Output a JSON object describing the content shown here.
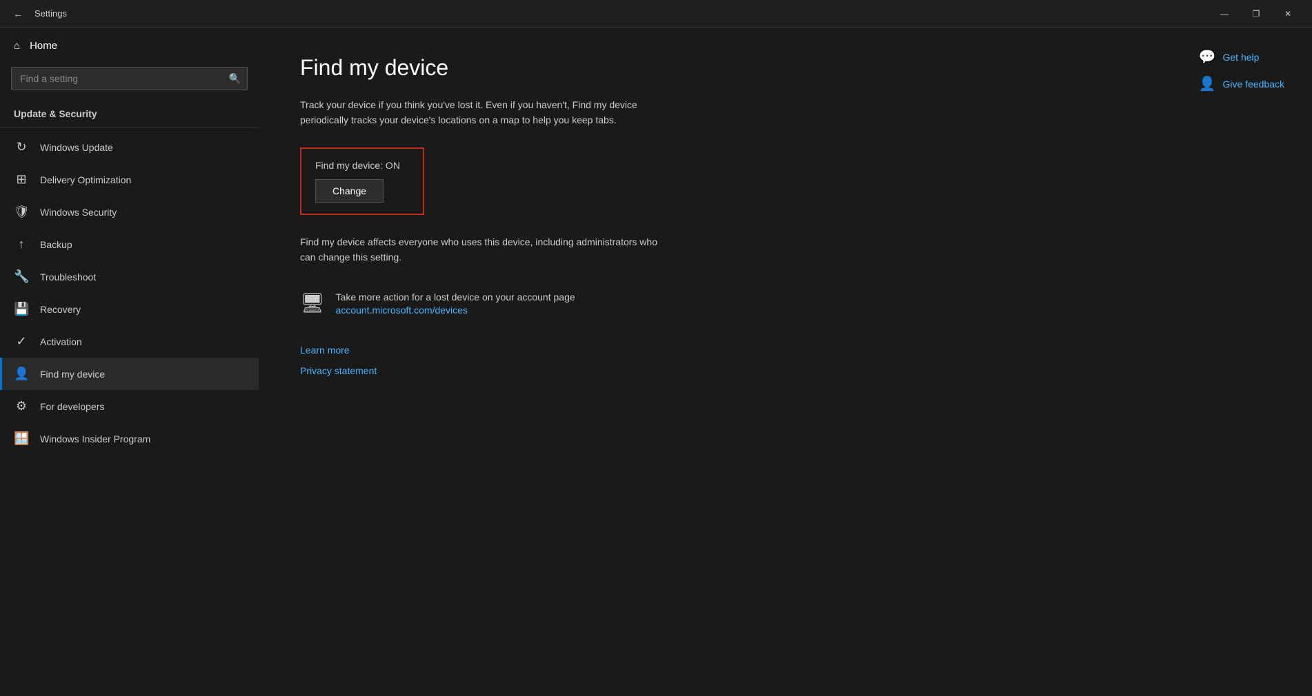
{
  "titlebar": {
    "title": "Settings",
    "back_label": "←",
    "minimize_label": "—",
    "restore_label": "❐",
    "close_label": "✕"
  },
  "sidebar": {
    "home_label": "Home",
    "search_placeholder": "Find a setting",
    "section_title": "Update & Security",
    "items": [
      {
        "id": "windows-update",
        "label": "Windows Update",
        "icon": "↻"
      },
      {
        "id": "delivery-optimization",
        "label": "Delivery Optimization",
        "icon": "⊞"
      },
      {
        "id": "windows-security",
        "label": "Windows Security",
        "icon": "🛡"
      },
      {
        "id": "backup",
        "label": "Backup",
        "icon": "↑"
      },
      {
        "id": "troubleshoot",
        "label": "Troubleshoot",
        "icon": "🔧"
      },
      {
        "id": "recovery",
        "label": "Recovery",
        "icon": "💾"
      },
      {
        "id": "activation",
        "label": "Activation",
        "icon": "✓"
      },
      {
        "id": "find-my-device",
        "label": "Find my device",
        "icon": "👤"
      },
      {
        "id": "for-developers",
        "label": "For developers",
        "icon": "⚙"
      },
      {
        "id": "windows-insider",
        "label": "Windows Insider Program",
        "icon": "🪟"
      }
    ]
  },
  "content": {
    "page_title": "Find my device",
    "description": "Track your device if you think you've lost it. Even if you haven't, Find my device periodically tracks your device's locations on a map to help you keep tabs.",
    "status_label": "Find my device: ON",
    "change_button": "Change",
    "affect_text": "Find my device affects everyone who uses this device, including administrators who can change this setting.",
    "account_action_label": "Take more action for a lost device on your account page",
    "account_link_text": "account.microsoft.com/devices",
    "account_link_href": "account.microsoft.com/devices",
    "learn_more": "Learn more",
    "privacy_statement": "Privacy statement"
  },
  "help": {
    "get_help": "Get help",
    "give_feedback": "Give feedback"
  }
}
